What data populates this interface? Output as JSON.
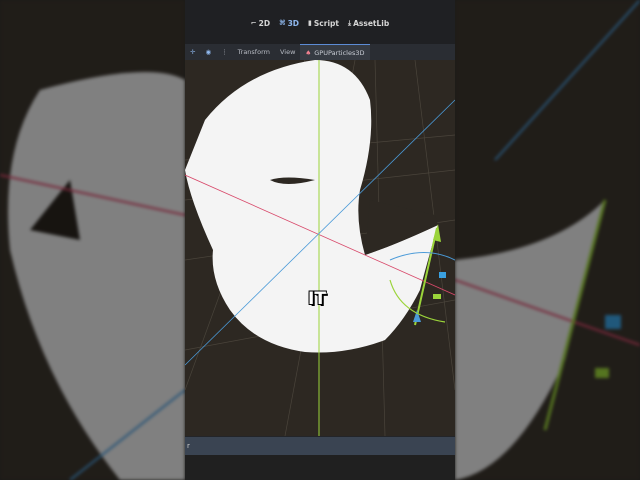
{
  "editor_tabs": [
    {
      "label": "2D",
      "icon": "2d-icon"
    },
    {
      "label": "3D",
      "icon": "3d-icon",
      "active": true
    },
    {
      "label": "Script",
      "icon": "script-icon"
    },
    {
      "label": "AssetLib",
      "icon": "download-icon"
    }
  ],
  "toolbar": {
    "transform": "Transform",
    "view": "View",
    "node_tab": "GPUParticles3D"
  },
  "bottom_panel": {
    "partial_label": "r"
  },
  "caption": "IT",
  "colors": {
    "x_axis": "#d8486a",
    "y_axis": "#9bd43a",
    "z_axis": "#4a9ad8",
    "mesh": "#f4f4f4"
  }
}
